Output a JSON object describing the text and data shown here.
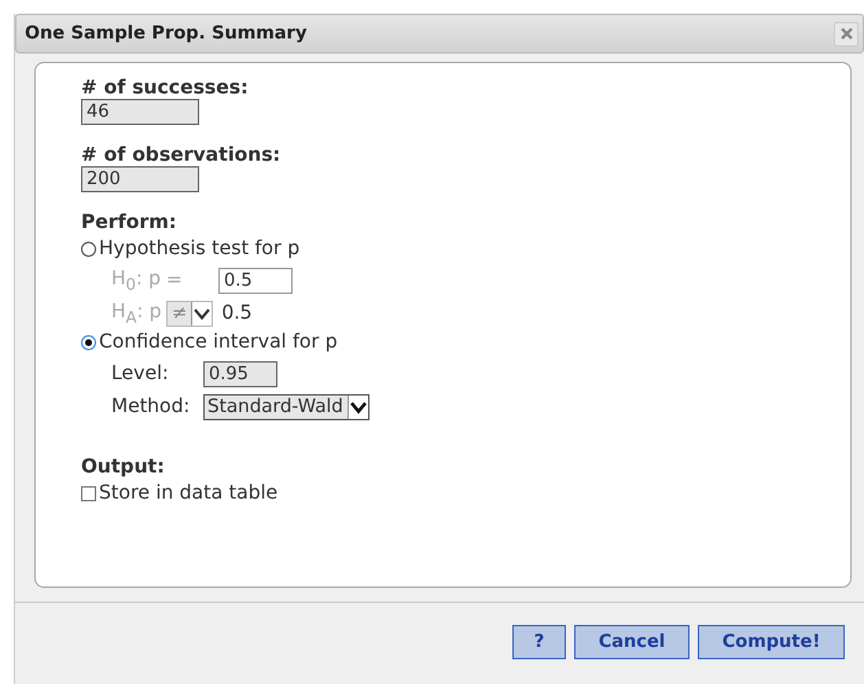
{
  "window": {
    "title": "One Sample Prop. Summary"
  },
  "fields": [
    {
      "label": "# of successes:",
      "value": "46"
    },
    {
      "label": "# of observations:",
      "value": "200"
    }
  ],
  "perform": {
    "label": "Perform:",
    "options": [
      {
        "label": "Hypothesis test for p",
        "selected": false,
        "rows": [
          {
            "kind": "input",
            "label": "H$_{0}$: p",
            "operator": "=",
            "value": "0.5"
          },
          {
            "kind": "select",
            "label": "H$_{A}$: p",
            "operator": "≠",
            "value": "0.5"
          }
        ]
      },
      {
        "label": "Confidence interval for p",
        "selected": true,
        "rows": [
          {
            "kind": "level",
            "label": "Level:",
            "value": "0.95"
          },
          {
            "kind": "method",
            "label": "Method:",
            "value": "Standard-Wald"
          }
        ]
      }
    ]
  },
  "output": {
    "label": "Output:",
    "checkbox": {
      "label": "Store in data table",
      "checked": false
    }
  },
  "buttons": [
    "?",
    "Cancel",
    "Compute!"
  ]
}
